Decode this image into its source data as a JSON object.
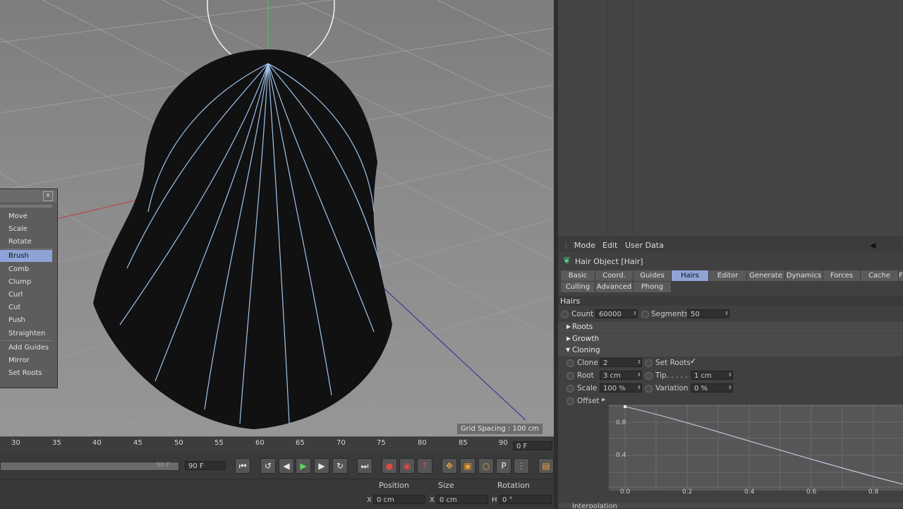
{
  "viewport": {
    "grid_spacing": "Grid Spacing : 100 cm"
  },
  "palette": {
    "close": "x",
    "items": [
      "Move",
      "Scale",
      "Rotate",
      "Brush",
      "Comb",
      "Clump",
      "Curl",
      "Cut",
      "Push",
      "Straighten",
      "Add Guides",
      "Mirror",
      "Set Roots"
    ],
    "active": "Brush"
  },
  "timeline": {
    "ticks": [
      "30",
      "35",
      "40",
      "45",
      "50",
      "55",
      "60",
      "65",
      "70",
      "75",
      "80",
      "85",
      "90"
    ],
    "current_frame": "0 F",
    "range_end": "90 F",
    "end_field": "90 F"
  },
  "coords": {
    "position": "Position",
    "size": "Size",
    "rotation": "Rotation",
    "x_label": "X",
    "x_value": "0 cm",
    "sx_label": "X",
    "sx_value": "0 cm",
    "h_label": "H",
    "h_value": "0 °"
  },
  "attr": {
    "menu": [
      "Mode",
      "Edit",
      "User Data"
    ],
    "object_title": "Hair Object [Hair]",
    "tabs_row1": [
      "Basic",
      "Coord.",
      "Guides",
      "Hairs",
      "Editor",
      "Generate",
      "Dynamics",
      "Forces",
      "Cache",
      "F"
    ],
    "tabs_row2": [
      "Culling",
      "Advanced",
      "Phong"
    ],
    "active_tab": "Hairs",
    "section_title": "Hairs",
    "count_label": "Count",
    "count_value": "60000",
    "segments_label": "Segments",
    "segments_value": "50",
    "roots": "Roots",
    "growth": "Growth",
    "cloning": "Cloning",
    "clone_label": "Clone",
    "clone_value": "2",
    "set_roots_label": "Set Roots",
    "set_roots_check": "✓",
    "root_label": "Root",
    "root_value": "3 cm",
    "tip_label": "Tip. . . . .",
    "tip_value": "1 cm",
    "scale_label": "Scale",
    "scale_value": "100 %",
    "variation_label": "Variation",
    "variation_value": "0 %",
    "offset_label": "Offset",
    "graph_y": [
      "0.8",
      "0.4"
    ],
    "graph_x": [
      "0.0",
      "0.2",
      "0.4",
      "0.6",
      "0.8"
    ],
    "interpolation": "Interpolation"
  }
}
